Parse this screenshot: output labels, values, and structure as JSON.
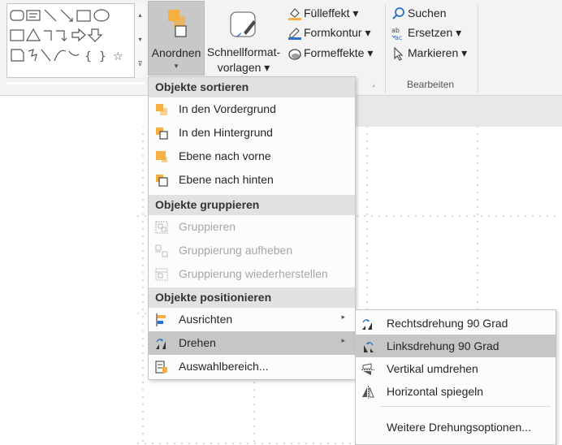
{
  "ribbon": {
    "arrange": {
      "label": "Anordnen",
      "caret": "▾"
    },
    "quick_styles": {
      "line1": "Schnellformat-",
      "line2": "vorlagen ▾"
    },
    "shape_fill": "Fülleffekt ▾",
    "shape_outline": "Formkontur ▾",
    "shape_effects": "Formeffekte ▾",
    "find": "Suchen",
    "replace": "Ersetzen ▾",
    "select": "Markieren ▾",
    "editing_group": "Bearbeiten",
    "launcher": "⌟",
    "gallery_up": "▴",
    "gallery_down": "▾",
    "gallery_more": "⊽"
  },
  "arrange_menu": {
    "sort_header": "Objekte sortieren",
    "bring_front": "In den Vordergrund",
    "send_back": "In den Hintergrund",
    "bring_forward": "Ebene nach vorne",
    "send_backward": "Ebene nach hinten",
    "group_header": "Objekte gruppieren",
    "group": "Gruppieren",
    "ungroup": "Gruppierung aufheben",
    "regroup": "Gruppierung wiederherstellen",
    "position_header": "Objekte positionieren",
    "align": "Ausrichten",
    "rotate": "Drehen",
    "selection_pane": "Auswahlbereich...",
    "submenu_arrow": "▸"
  },
  "rotate_menu": {
    "rotate_right": "Rechtsdrehung 90 Grad",
    "rotate_left": "Linksdrehung 90 Grad",
    "flip_vertical": "Vertikal umdrehen",
    "flip_horizontal": "Horizontal spiegeln",
    "more_options": "Weitere Drehungsoptionen..."
  },
  "colors": {
    "accent_orange": "#f5b041",
    "accent_blue": "#2f6fc7",
    "selected_bg": "#c6c6c6",
    "header_bg": "#e1e1e1"
  }
}
